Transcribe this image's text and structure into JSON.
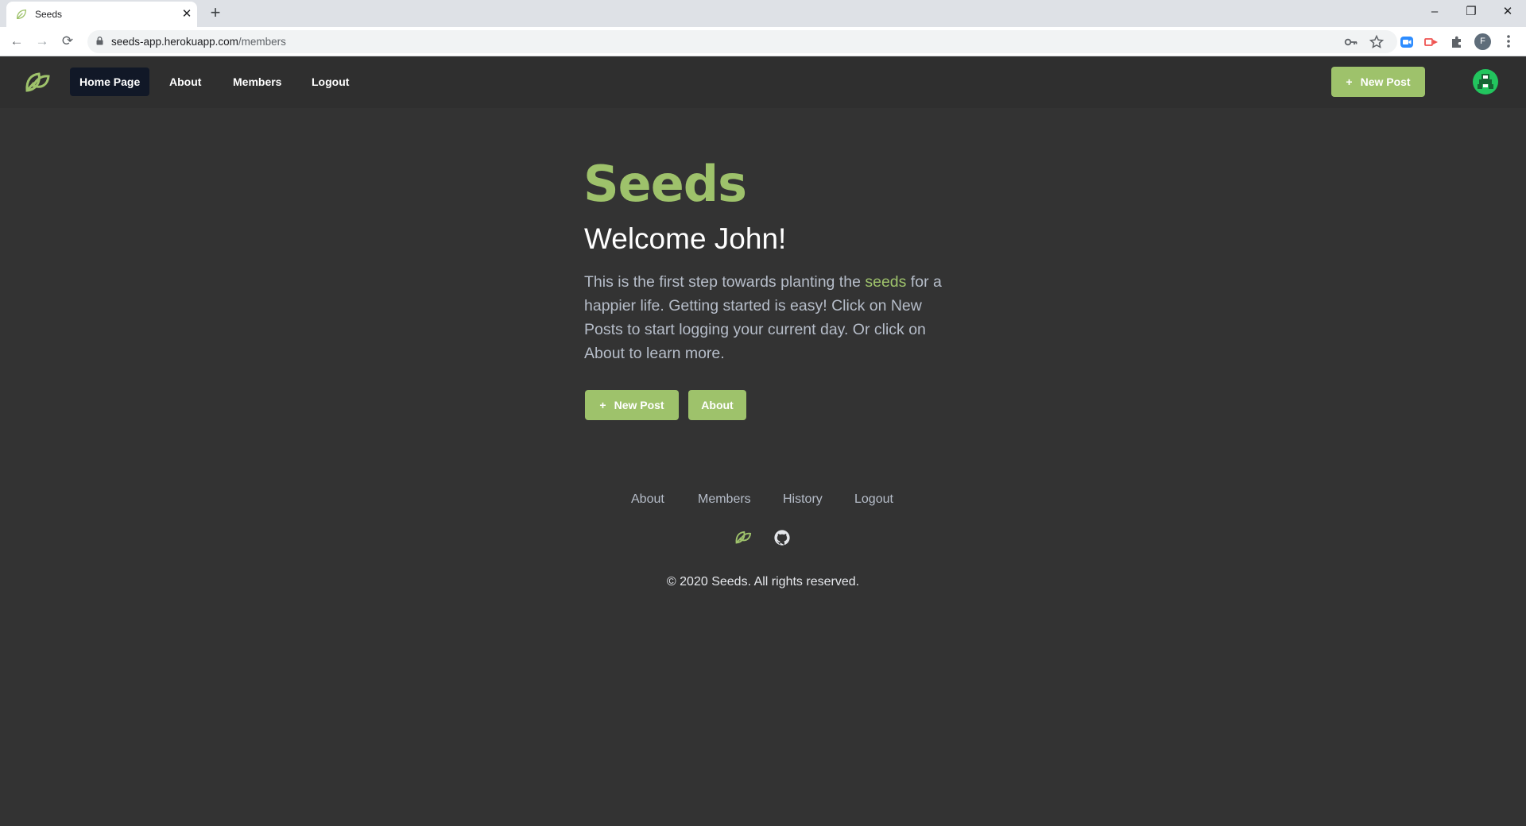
{
  "browser": {
    "tab_title": "Seeds",
    "tab_close": "✕",
    "new_tab": "+",
    "url_host": "seeds-app.herokuapp.com",
    "url_path": "/members",
    "profile_initial": "F",
    "window_controls": {
      "minimize": "–",
      "restore": "❐",
      "close": "✕"
    },
    "nav_buttons": {
      "back": "←",
      "forward": "→",
      "reload": "⟳"
    }
  },
  "site_nav": {
    "links": [
      {
        "label": "Home Page",
        "active": true
      },
      {
        "label": "About"
      },
      {
        "label": "Members"
      },
      {
        "label": "Logout"
      }
    ],
    "new_post_label": "New Post"
  },
  "hero": {
    "brand": "Seeds",
    "welcome": "Welcome John!",
    "intro_before": "This is the first step towards planting the ",
    "intro_highlight": "seeds",
    "intro_after": " for a happier life. Getting started is easy! Click on New Posts to start logging your current day. Or click on About to learn more.",
    "new_post_label": "New Post",
    "about_label": "About"
  },
  "footer": {
    "links": [
      "About",
      "Members",
      "History",
      "Logout"
    ],
    "copyright": "© 2020 Seeds. All rights reserved."
  },
  "colors": {
    "accent": "#9ec26b",
    "page_bg": "#333333",
    "nav_bg": "#2f2f2f",
    "active_nav": "#111827",
    "muted_text": "#b6bdc9"
  }
}
